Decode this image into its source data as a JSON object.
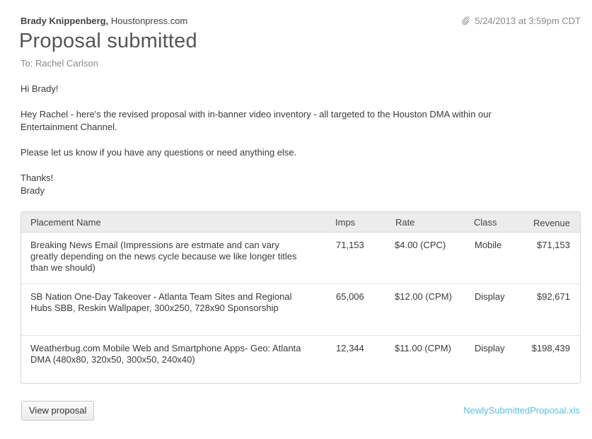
{
  "message": {
    "sender_name": "Brady Knippenberg,",
    "sender_org": "Houstonpress.com",
    "timestamp": "5/24/2013 at 3:59pm CDT",
    "title": "Proposal submitted",
    "recipient": "To: Rachel Carlson",
    "body": {
      "greeting": "Hi Brady!",
      "paragraph1": "Hey Rachel - here's the revised proposal with in-banner video inventory - all targeted to the Houston DMA within our Entertainment Channel.",
      "paragraph2": "Please let us know if you have any questions or need anything else.",
      "signoff": "Thanks!",
      "signature": "Brady"
    }
  },
  "table": {
    "headers": {
      "name": "Placement Name",
      "imps": "Imps",
      "rate": "Rate",
      "class": "Class",
      "revenue": "Revenue"
    },
    "rows": [
      {
        "name": "Breaking News Email (Impressions are estmate and can vary greatly depending on the news cycle because we like longer titles than we should)",
        "imps": "71,153",
        "rate": "$4.00 (CPC)",
        "class": "Mobile",
        "revenue": "$71,153"
      },
      {
        "name": "SB Nation One-Day Takeover - Atlanta Team Sites and Regional Hubs SBB, Reskin Wallpaper, 300x250, 728x90 Sponsorship",
        "imps": "65,006",
        "rate": "$12.00 (CPM)",
        "class": "Display",
        "revenue": "$92,671"
      },
      {
        "name": "Weatherbug.com Mobile Web and Smartphone Apps- Geo: Atlanta DMA (480x80, 320x50, 300x50, 240x40)",
        "imps": "12,344",
        "rate": "$11.00 (CPM)",
        "class": "Display",
        "revenue": "$198,439"
      }
    ]
  },
  "actions": {
    "view_proposal": "View proposal",
    "attachment": "NewlySubmittedProposal.xls"
  },
  "icons": {
    "timestamp_icon": "paperclip-icon"
  },
  "colors": {
    "link": "#5bbfe0",
    "header_bg": "#ececec"
  }
}
